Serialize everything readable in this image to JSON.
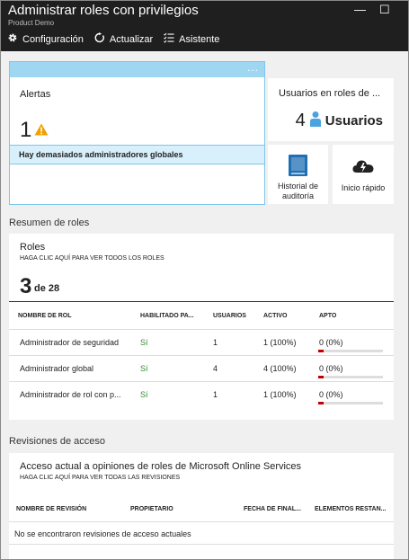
{
  "window": {
    "title": "Administrar roles con privilegios",
    "subtitle": "Product Demo",
    "minimize_label": "—",
    "maximize_label": "☐"
  },
  "toolbar": {
    "settings_label": "Configuración",
    "refresh_label": "Actualizar",
    "wizard_label": "Asistente"
  },
  "alerts": {
    "more_label": "...",
    "title": "Alertas",
    "count": "1",
    "message": "Hay demasiados administradores globales"
  },
  "users_tile": {
    "title": "Usuarios en roles de ...",
    "count": "4",
    "label": "Usuarios"
  },
  "tiles": [
    {
      "label": "Historial de auditoría",
      "icon": "book-icon"
    },
    {
      "label": "Inicio rápido",
      "icon": "cloud-bolt-icon"
    }
  ],
  "roles_summary": {
    "section_label": "Resumen de roles",
    "title": "Roles",
    "link": "HAGA CLIC AQUÍ PARA VER TODOS LOS ROLES",
    "count": "3",
    "of_total": "de 28",
    "columns": [
      "NOMBRE DE ROL",
      "HABILITADO PA...",
      "USUARIOS",
      "ACTIVO",
      "APTO"
    ],
    "rows": [
      {
        "name": "Administrador de seguridad",
        "enabled": "Sí",
        "users": "1",
        "active": "1 (100%)",
        "eligible": "0 (0%)",
        "eligible_fraction": 0
      },
      {
        "name": "Administrador global",
        "enabled": "Sí",
        "users": "4",
        "active": "4 (100%)",
        "eligible": "0 (0%)",
        "eligible_fraction": 0
      },
      {
        "name": "Administrador de rol con p...",
        "enabled": "Sí",
        "users": "1",
        "active": "1 (100%)",
        "eligible": "0 (0%)",
        "eligible_fraction": 0
      }
    ]
  },
  "access_reviews": {
    "section_label": "Revisiones de acceso",
    "title": "Acceso actual a opiniones de roles de Microsoft Online Services",
    "link": "HAGA CLIC AQUÍ PARA VER TODAS LAS REVISIONES",
    "columns": [
      "NOMBRE DE REVISIÓN",
      "PROPIETARIO",
      "FECHA DE FINAL...",
      "ELEMENTOS RESTAN..."
    ],
    "empty_message": "No se encontraron revisiones de acceso actuales"
  },
  "colors": {
    "header_bg": "#1f1f1f",
    "selected_accent": "#9fd6f2",
    "warning": "#f0a000",
    "enabled_text": "#2e8b2e",
    "eligible_bar": "#c00000",
    "icon_blue": "#1f6fb5"
  }
}
